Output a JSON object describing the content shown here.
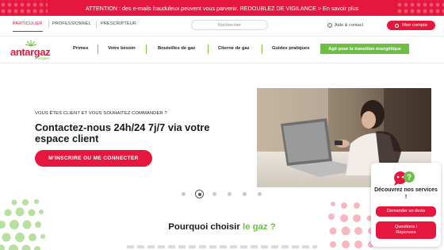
{
  "alert": {
    "text": "ATTENTION : des e-mails frauduleux peuvent vous parvenir. REDOUBLEZ DE VIGILANCE > En savoir plus"
  },
  "topbar": {
    "segments": [
      "PARTICULIER",
      "PROFESSIONNEL",
      "PRESCRIPTEUR"
    ],
    "active_segment": "PARTICULIER",
    "search_placeholder": "Rechercher",
    "help_label": "Aide & contact",
    "account_label": "Mon compte"
  },
  "logo": {
    "name": "antargaz",
    "sub": "énergies"
  },
  "nav": {
    "items": [
      "Primes",
      "Votre besoin",
      "Bouteilles de gaz",
      "Citerne de gaz",
      "Guides pratiques"
    ],
    "highlight": "Agir pour la transition énergétique"
  },
  "hero": {
    "eyebrow": "VOUS ÊTES CLIENT ET VOUS SOUHAITEZ COMMANDER ?",
    "title": "Contactez-nous 24h/24 7j/7 via votre espace client",
    "cta": "M'INSCRIRE OU ME CONNECTER"
  },
  "carousel": {
    "count": 6,
    "active_index": 1
  },
  "section": {
    "title_prefix": "Pourquoi choisir ",
    "title_highlight": "le gaz ?"
  },
  "widget": {
    "title": "Découvrez nos services !",
    "buttons": [
      "Demander un devis",
      "Questions / Réponses"
    ]
  },
  "colors": {
    "brand_red": "#e5173f",
    "brand_green": "#6fbe44"
  }
}
